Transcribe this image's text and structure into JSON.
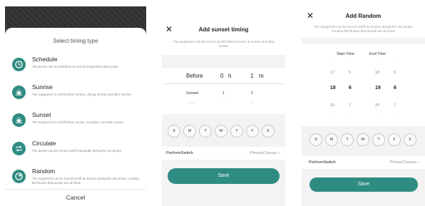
{
  "panel1": {
    "sheet_title": "Select timing type",
    "items": [
      {
        "name": "Schedule",
        "desc": "The device can be switched on and off at specified time points"
      },
      {
        "name": "Sunrise",
        "desc": "The equipment is on/off before sunrise, during sunrise and after sunrise"
      },
      {
        "name": "Sunset",
        "desc": "The equipment is on/off before sunset, at sunset, and after sunset"
      },
      {
        "name": "Circulate",
        "desc": "The device can be turned on/off repeatedly during the set period"
      },
      {
        "name": "Random",
        "desc": "The equipment can be turned on/off at random during the set period, creating the illusion that people are at home"
      }
    ],
    "cancel": "Cancel"
  },
  "panel2": {
    "close": "✕",
    "title": "Add sunset timing",
    "subtitle": "The equipment can be turned on/off before sunset, at sunset and after sunset",
    "selected": {
      "mode": "Before",
      "hours": "0",
      "h_unit": "h",
      "minutes": "1",
      "m_unit": "m"
    },
    "next_row": {
      "mode": "Sunset",
      "hours": "1",
      "minutes": "2"
    },
    "third_row": {
      "mode": "------",
      "hours": "--",
      "minutes": "--"
    },
    "days": [
      "S",
      "M",
      "T",
      "W",
      "T",
      "F",
      "S"
    ],
    "perform_label": "PerformSwitch",
    "perform_value": "PleaseChoose",
    "chevron": "›",
    "save": "Save"
  },
  "panel3": {
    "close": "✕",
    "title": "Add Random",
    "subtitle": "The equipment can be turned on/off at random during the set period, creating the illusion that people are at home",
    "start_label": "Start Time",
    "end_label": "End Time",
    "start_hours": [
      "--",
      "17",
      "18",
      "19",
      "--"
    ],
    "start_minutes": [
      "--",
      "5",
      "6",
      "7",
      "--"
    ],
    "end_hours": [
      "--",
      "18",
      "19",
      "20",
      "--"
    ],
    "end_minutes": [
      "--",
      "5",
      "6",
      "7",
      "--"
    ],
    "days": [
      "S",
      "M",
      "T",
      "W",
      "T",
      "F",
      "S"
    ],
    "perform_label": "PerformSwitch",
    "perform_value": "PleaseChoose",
    "chevron": "›",
    "save": "Save"
  },
  "colors": {
    "accent": "#2f8c82"
  }
}
